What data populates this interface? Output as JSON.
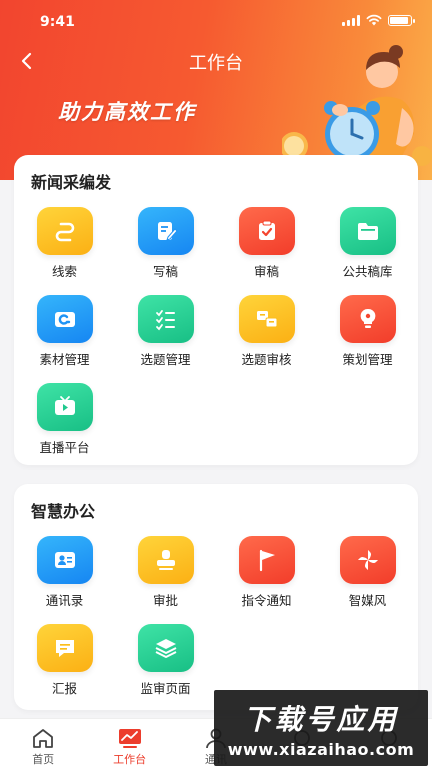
{
  "status_bar": {
    "time": "9:41",
    "battery_level": 0.9
  },
  "nav": {
    "title": "工作台",
    "back_icon": "chevron-left-icon"
  },
  "banner": {
    "slogan": "助力高效工作"
  },
  "sections": [
    {
      "title": "新闻采编发",
      "items": [
        {
          "label": "线索",
          "icon": "clue-link-icon",
          "color": "#fcbe1c"
        },
        {
          "label": "写稿",
          "icon": "write-document-icon",
          "color": "#1e93f5"
        },
        {
          "label": "审稿",
          "icon": "review-clipboard-icon",
          "color": "#f4452f"
        },
        {
          "label": "公共稿库",
          "icon": "folder-icon",
          "color": "#20c98e"
        },
        {
          "label": "素材管理",
          "icon": "material-card-icon",
          "color": "#1e93f5"
        },
        {
          "label": "选题管理",
          "icon": "checklist-icon",
          "color": "#20c98e"
        },
        {
          "label": "选题审核",
          "icon": "topic-review-icon",
          "color": "#fcbe1c"
        },
        {
          "label": "策划管理",
          "icon": "lightbulb-icon",
          "color": "#f4452f"
        },
        {
          "label": "直播平台",
          "icon": "tv-play-icon",
          "color": "#20c98e"
        }
      ]
    },
    {
      "title": "智慧办公",
      "items": [
        {
          "label": "通讯录",
          "icon": "contacts-icon",
          "color": "#1e93f5"
        },
        {
          "label": "审批",
          "icon": "stamp-icon",
          "color": "#fcbe1c"
        },
        {
          "label": "指令通知",
          "icon": "flag-icon",
          "color": "#f4452f"
        },
        {
          "label": "智媒风",
          "icon": "pinwheel-icon",
          "color": "#f4452f"
        },
        {
          "label": "汇报",
          "icon": "report-chat-icon",
          "color": "#fcbe1c"
        },
        {
          "label": "监审页面",
          "icon": "layers-icon",
          "color": "#20c98e"
        }
      ]
    }
  ],
  "tab_bar": [
    {
      "label": "首页",
      "icon": "home-icon",
      "active": false
    },
    {
      "label": "工作台",
      "icon": "workbench-chart-icon",
      "active": true
    },
    {
      "label": "通讯",
      "icon": "person-icon",
      "active": false
    },
    {
      "label": "",
      "icon": "tab-4-icon",
      "active": false
    },
    {
      "label": "",
      "icon": "tab-5-icon",
      "active": false
    }
  ],
  "watermark": {
    "title": "下载号应用",
    "url": "www.xiazaihao.com"
  },
  "colors": {
    "accent": "#ec3d2c",
    "header_start": "#f2452f",
    "header_end": "#fbb04a"
  }
}
